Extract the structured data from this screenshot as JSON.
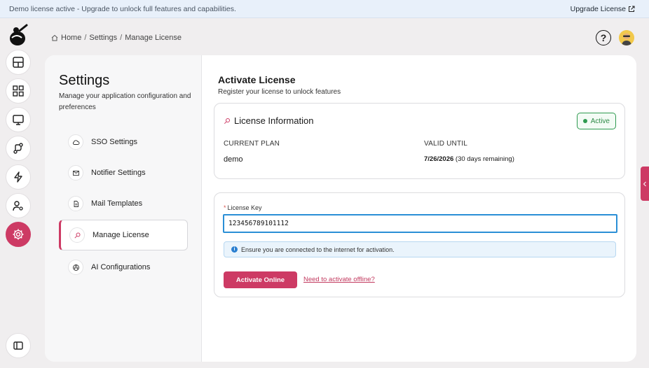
{
  "banner": {
    "message": "Demo license active - Upgrade to unlock full features and capabilities.",
    "upgrade_label": "Upgrade License"
  },
  "breadcrumb": {
    "home": "Home",
    "sep": "/",
    "settings": "Settings",
    "current": "Manage License"
  },
  "header": {
    "help_symbol": "?"
  },
  "nav_rail": {
    "items": [
      {
        "name": "layout-icon"
      },
      {
        "name": "dashboard-icon"
      },
      {
        "name": "monitor-icon"
      },
      {
        "name": "workflow-icon"
      },
      {
        "name": "lightning-icon"
      },
      {
        "name": "user-settings-icon"
      },
      {
        "name": "settings-icon",
        "active": true
      },
      {
        "name": "sidebar-toggle-icon"
      }
    ]
  },
  "settings": {
    "title": "Settings",
    "subtitle": "Manage your application configuration and preferences",
    "menu": [
      {
        "label": "SSO Settings",
        "icon": "cloud-icon"
      },
      {
        "label": "Notifier Settings",
        "icon": "mail-icon"
      },
      {
        "label": "Mail Templates",
        "icon": "file-icon"
      },
      {
        "label": "Manage License",
        "icon": "key-icon",
        "active": true
      },
      {
        "label": "AI Configurations",
        "icon": "ai-icon"
      }
    ]
  },
  "activate": {
    "title": "Activate License",
    "subtitle": "Register your license to unlock features"
  },
  "license_info": {
    "title": "License Information",
    "status": "Active",
    "plan_label": "CURRENT PLAN",
    "plan_value": "demo",
    "valid_label": "VALID UNTIL",
    "valid_date": "7/26/2026",
    "valid_remaining": "(30 days remaining)"
  },
  "license_form": {
    "required_mark": "*",
    "key_label": "License Key",
    "key_value": "123456789101112",
    "info_text": "Ensure you are connected to the internet for activation.",
    "activate_button": "Activate Online",
    "offline_link": "Need to activate offline?"
  },
  "colors": {
    "accent": "#cd3a64",
    "success": "#2e9a4f",
    "focus": "#2a8fd6",
    "info_bg": "#eaf4fc"
  }
}
